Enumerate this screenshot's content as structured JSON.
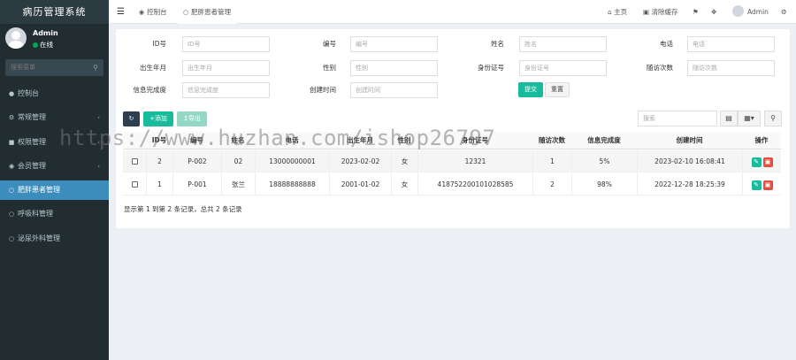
{
  "app": {
    "title": "病历管理系统"
  },
  "user": {
    "name": "Admin",
    "status": "在线"
  },
  "sidebar": {
    "search_placeholder": "搜索菜单",
    "items": [
      {
        "label": "控制台",
        "icon": "dashboard-icon",
        "arrow": ""
      },
      {
        "label": "常规管理",
        "icon": "cogs-icon",
        "arrow": "‹"
      },
      {
        "label": "权限管理",
        "icon": "group-icon",
        "arrow": "‹"
      },
      {
        "label": "会员管理",
        "icon": "user-circle-icon",
        "arrow": "‹"
      },
      {
        "label": "肥胖患者管理",
        "icon": "circle-icon",
        "arrow": ""
      },
      {
        "label": "呼吸科管理",
        "icon": "circle-icon",
        "arrow": ""
      },
      {
        "label": "泌尿外科管理",
        "icon": "circle-icon",
        "arrow": ""
      }
    ]
  },
  "topbar": {
    "tabs": [
      {
        "label": "控制台",
        "icon": "dashboard-icon"
      },
      {
        "label": "肥胖患者管理",
        "icon": "circle-icon"
      }
    ],
    "home": "主页",
    "clear_cache": "清除缓存",
    "admin": "Admin"
  },
  "filters": {
    "fields": [
      {
        "label": "ID号",
        "placeholder": "ID号"
      },
      {
        "label": "编号",
        "placeholder": "编号"
      },
      {
        "label": "姓名",
        "placeholder": "姓名"
      },
      {
        "label": "电话",
        "placeholder": "电话"
      },
      {
        "label": "出生年月",
        "placeholder": "出生年月"
      },
      {
        "label": "性别",
        "placeholder": "性别"
      },
      {
        "label": "身份证号",
        "placeholder": "身份证号"
      },
      {
        "label": "随访次数",
        "placeholder": "随访次数"
      },
      {
        "label": "信息完成度",
        "placeholder": "信息完成度"
      },
      {
        "label": "创建时间",
        "placeholder": "创建时间"
      }
    ],
    "submit": "提交",
    "reset": "重置"
  },
  "toolbar": {
    "add": "添加",
    "export": "导出",
    "search_placeholder": "搜索"
  },
  "table": {
    "columns": [
      "ID号",
      "编号",
      "姓名",
      "电话",
      "出生年月",
      "性别",
      "身份证号",
      "随访次数",
      "信息完成度",
      "创建时间",
      "操作"
    ],
    "rows": [
      {
        "id": "2",
        "code": "P-002",
        "name": "02",
        "phone": "13000000001",
        "birth": "2023-02-02",
        "gender": "女",
        "idcard": "12321",
        "visits": "1",
        "completion": "5%",
        "created": "2023-02-10 16:08:41"
      },
      {
        "id": "1",
        "code": "P-001",
        "name": "张兰",
        "phone": "18888888888",
        "birth": "2001-01-02",
        "gender": "女",
        "idcard": "418752200101028585",
        "visits": "2",
        "completion": "98%",
        "created": "2022-12-28 18:25:39"
      }
    ]
  },
  "pager": {
    "text": "显示第 1 到第 2 条记录，总共 2 条记录"
  },
  "watermark": "https://www.huzhan.com/ishop26797"
}
